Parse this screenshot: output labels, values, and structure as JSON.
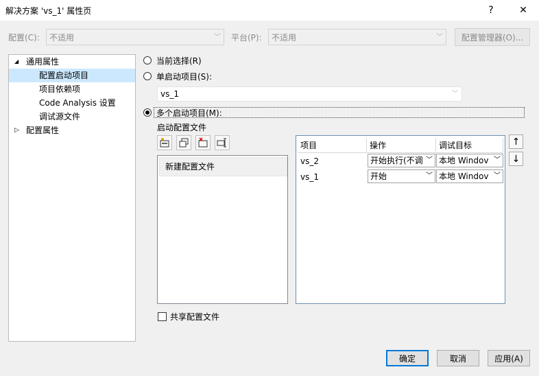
{
  "window": {
    "title": "解决方案 'vs_1' 属性页",
    "help_glyph": "?",
    "close_glyph": "✕"
  },
  "topbar": {
    "config_label": "配置(C):",
    "config_value": "不适用",
    "platform_label": "平台(P):",
    "platform_value": "不适用",
    "config_manager": "配置管理器(O)..."
  },
  "tree": {
    "items": [
      {
        "label": "通用属性",
        "expander": "◢"
      },
      {
        "label": "配置启动项目"
      },
      {
        "label": "项目依赖项"
      },
      {
        "label": "Code Analysis 设置"
      },
      {
        "label": "调试源文件"
      },
      {
        "label": "配置属性",
        "expander": "▷"
      }
    ]
  },
  "startup": {
    "current_selection": "当前选择(R)",
    "single_startup": "单启动项目(S):",
    "single_value": "vs_1",
    "multiple_startup": "多个启动项目(M):",
    "selected_option": "multiple",
    "profile_label": "启动配置文件",
    "profiles": [
      "新建配置文件"
    ],
    "share_profile": "共享配置文件",
    "share_checked": false
  },
  "grid": {
    "headers": [
      "项目",
      "操作",
      "调试目标"
    ],
    "rows": [
      {
        "project": "vs_2",
        "action": "开始执行(不调",
        "target": "本地 Windov"
      },
      {
        "project": "vs_1",
        "action": "开始",
        "target": "本地 Windov"
      }
    ]
  },
  "move": {
    "up": "↑",
    "down": "↓"
  },
  "buttons": {
    "ok": "确定",
    "cancel": "取消",
    "apply": "应用(A)"
  },
  "colors": {
    "selection": "#cce8ff",
    "default_button_border": "#0078d7"
  }
}
